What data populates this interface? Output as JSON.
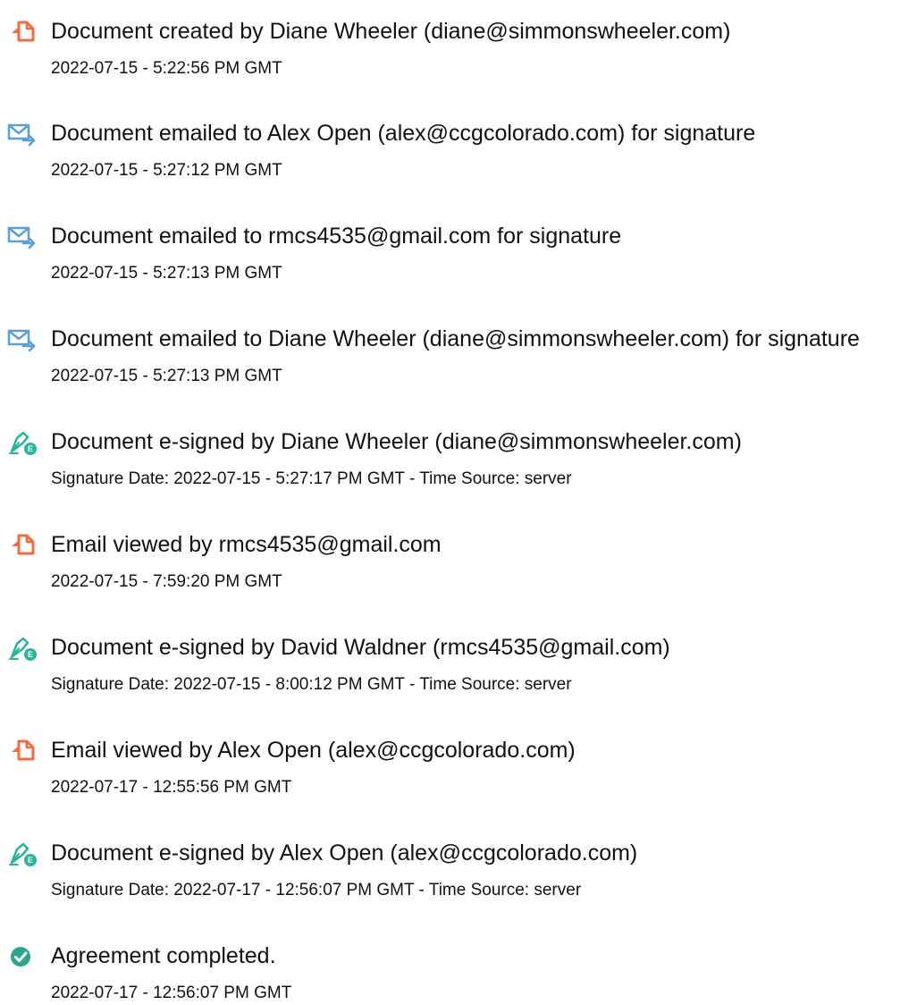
{
  "colors": {
    "document_icon": "#EE6D3F",
    "email_icon": "#5A9FD6",
    "sign_icon": "#2DB39B",
    "complete_icon": "#2DA58E",
    "text": "#111111"
  },
  "events": [
    {
      "icon": "document-icon",
      "title": "Document created by Diane Wheeler (diane@simmonswheeler.com)",
      "detail": "2022-07-15 - 5:22:56 PM GMT"
    },
    {
      "icon": "email-icon",
      "title": "Document emailed to Alex Open (alex@ccgcolorado.com) for signature",
      "detail": "2022-07-15 - 5:27:12 PM GMT"
    },
    {
      "icon": "email-icon",
      "title": "Document emailed to rmcs4535@gmail.com for signature",
      "detail": "2022-07-15 - 5:27:13 PM GMT"
    },
    {
      "icon": "email-icon",
      "title": "Document emailed to Diane Wheeler (diane@simmonswheeler.com) for signature",
      "detail": "2022-07-15 - 5:27:13 PM GMT"
    },
    {
      "icon": "e-sign-icon",
      "title": "Document e-signed by Diane Wheeler (diane@simmonswheeler.com)",
      "detail": "Signature Date: 2022-07-15 - 5:27:17 PM GMT - Time Source: server"
    },
    {
      "icon": "document-icon",
      "title": "Email viewed by rmcs4535@gmail.com",
      "detail": "2022-07-15 - 7:59:20 PM GMT"
    },
    {
      "icon": "e-sign-icon",
      "title": "Document e-signed by David Waldner (rmcs4535@gmail.com)",
      "detail": "Signature Date: 2022-07-15 - 8:00:12 PM GMT - Time Source: server"
    },
    {
      "icon": "document-icon",
      "title": "Email viewed by Alex Open (alex@ccgcolorado.com)",
      "detail": "2022-07-17 - 12:55:56 PM GMT"
    },
    {
      "icon": "e-sign-icon",
      "title": "Document e-signed by Alex Open (alex@ccgcolorado.com)",
      "detail": "Signature Date: 2022-07-17 - 12:56:07 PM GMT - Time Source: server"
    },
    {
      "icon": "check-circle-icon",
      "title": "Agreement completed.",
      "detail": "2022-07-17 - 12:56:07 PM GMT"
    }
  ]
}
